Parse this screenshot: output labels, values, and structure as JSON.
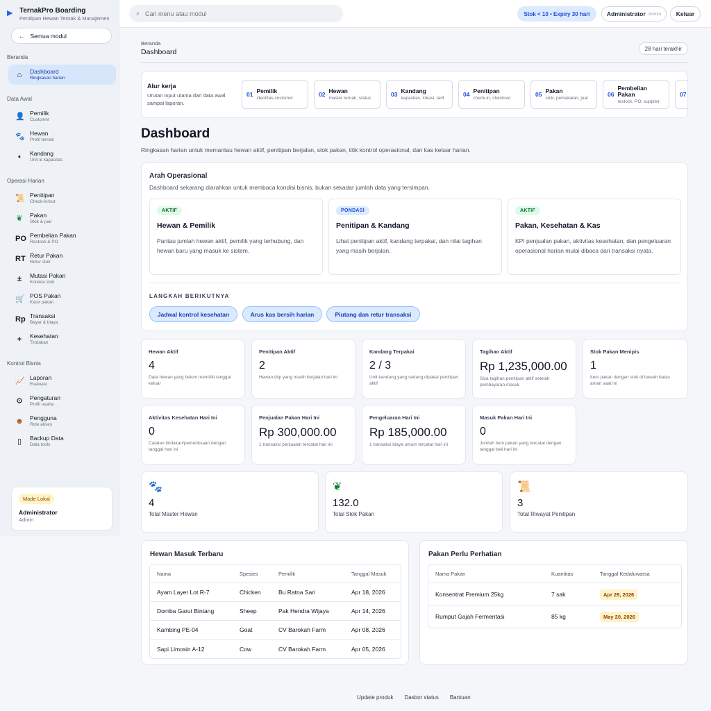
{
  "app": {
    "title": "TernakPro Boarding",
    "subtitle": "Penitipan Hewan Ternak & Manajemen"
  },
  "sidebar": {
    "all_modules": "Semua modul",
    "sections": [
      {
        "label": "Beranda",
        "items": [
          {
            "label": "Dashboard",
            "sub": "Ringkasan harian",
            "icon": "home-icon",
            "active": true
          }
        ]
      },
      {
        "label": "Data Awal",
        "items": [
          {
            "label": "Pemilik",
            "sub": "Customer",
            "icon": "user-icon"
          },
          {
            "label": "Hewan",
            "sub": "Profil ternak",
            "icon": "paw-icon"
          },
          {
            "label": "Kandang",
            "sub": "Unit & kapasitas",
            "icon": "barn-icon"
          }
        ]
      },
      {
        "label": "Operasi Harian",
        "items": [
          {
            "label": "Penitipan",
            "sub": "Check-in/out",
            "icon": "scroll-icon"
          },
          {
            "label": "Pakan",
            "sub": "Stok & jual",
            "icon": "leaf-icon"
          },
          {
            "label": "Pembelian Pakan",
            "sub": "Restock & PO",
            "icon": "po-icon"
          },
          {
            "label": "Retur Pakan",
            "sub": "Retur stok",
            "icon": "rt-icon"
          },
          {
            "label": "Mutasi Pakan",
            "sub": "Koreksi stok",
            "icon": "plus-minus-icon"
          },
          {
            "label": "POS Pakan",
            "sub": "Kasir pakan",
            "icon": "cart-icon"
          },
          {
            "label": "Transaksi",
            "sub": "Bayar & biaya",
            "icon": "rp-icon"
          },
          {
            "label": "Kesehatan",
            "sub": "Tindakan",
            "icon": "plus-icon"
          }
        ]
      },
      {
        "label": "Kontrol Bisnis",
        "items": [
          {
            "label": "Laporan",
            "sub": "Evaluasi",
            "icon": "chart-icon"
          },
          {
            "label": "Pengaturan",
            "sub": "Profil usaha",
            "icon": "gear-icon"
          },
          {
            "label": "Pengguna",
            "sub": "Role akses",
            "icon": "users-icon"
          },
          {
            "label": "Backup Data",
            "sub": "Data tools",
            "icon": "backup-icon"
          }
        ]
      }
    ],
    "mode": "Mode Lokal",
    "user": "Administrator",
    "role": "Admin"
  },
  "topbar": {
    "search_placeholder": "Cari menu atau modul",
    "stock_alert": "Stok < 10 • Expiry 30 hari",
    "user": "Administrator",
    "role": "Admin",
    "logout": "Keluar"
  },
  "breadcrumb": {
    "parent": "Beranda",
    "current": "Dashboard"
  },
  "range": "28 hari terakhir",
  "workflow": {
    "title": "Alur kerja",
    "desc": "Urutan input utama dari data awal sampai laporan.",
    "steps": [
      {
        "n": "01",
        "title": "Pemilik",
        "sub": "identitas customer"
      },
      {
        "n": "02",
        "title": "Hewan",
        "sub": "master ternak, status"
      },
      {
        "n": "03",
        "title": "Kandang",
        "sub": "kapasitas, lokasi, tarif"
      },
      {
        "n": "04",
        "title": "Penitipan",
        "sub": "check-in, checkout"
      },
      {
        "n": "05",
        "title": "Pakan",
        "sub": "stok, pemakaian, jual"
      },
      {
        "n": "06",
        "title": "Pembelian Pakan",
        "sub": "restock, PO, supplier"
      },
      {
        "n": "07",
        "title": "",
        "sub": ""
      }
    ]
  },
  "page": {
    "title": "Dashboard",
    "subtitle": "Ringkasan harian untuk memantau hewan aktif, penitipan berjalan, stok pakan, titik kontrol operasional, dan kas keluar harian."
  },
  "direction": {
    "title": "Arah Operasional",
    "subtitle": "Dashboard sekarang diarahkan untuk membaca kondisi bisnis, bukan sekadar jumlah data yang tersimpan.",
    "cards": [
      {
        "tag": "AKTIF",
        "tone": "g",
        "title": "Hewan & Pemilik",
        "desc": "Pantau jumlah hewan aktif, pemilik yang terhubung, dan hewan baru yang masuk ke sistem."
      },
      {
        "tag": "PONDASI",
        "tone": "b",
        "title": "Penitipan & Kandang",
        "desc": "Lihat penitipan aktif, kandang terpakai, dan nilai tagihan yang masih berjalan."
      },
      {
        "tag": "AKTIF",
        "tone": "g",
        "title": "Pakan, Kesehatan & Kas",
        "desc": "KPI penjualan pakan, aktivitas kesehatan, dan pengeluaran operasional harian mulai dibaca dari transaksi nyata."
      }
    ],
    "next_label": "LANGKAH BERIKUTNYA",
    "next": [
      "Jadwal kontrol kesehatan",
      "Arus kas bersih harian",
      "Piutang dan retur transaksi"
    ]
  },
  "kpis": [
    {
      "label": "Hewan Aktif",
      "value": "4",
      "desc": "Data hewan yang belum memiliki tanggal keluar"
    },
    {
      "label": "Penitipan Aktif",
      "value": "2",
      "desc": "Hewan titip yang masih berjalan hari ini"
    },
    {
      "label": "Kandang Terpakai",
      "value": "2 / 3",
      "desc": "Unit kandang yang sedang dipakai penitipan aktif"
    },
    {
      "label": "Tagihan Aktif",
      "value": "Rp 1,235,000.00",
      "desc": "Sisa tagihan penitipan aktif setelah pembayaran masuk"
    },
    {
      "label": "Stok Pakan Menipis",
      "value": "1",
      "desc": "Item pakan dengan stok di bawah batas aman saat ini"
    },
    {
      "label": "Aktivitas Kesehatan Hari Ini",
      "value": "0",
      "desc": "Catatan tindakan/pemeriksaan dengan tanggal hari ini"
    },
    {
      "label": "Penjualan Pakan Hari Ini",
      "value": "Rp 300,000.00",
      "desc": "1 transaksi penjualan tercatat hari ini"
    },
    {
      "label": "Pengeluaran Hari Ini",
      "value": "Rp 185,000.00",
      "desc": "1 transaksi biaya umum tercatat hari ini"
    },
    {
      "label": "Masuk Pakan Hari Ini",
      "value": "0",
      "desc": "Jumlah item pakan yang tercatat dengan tanggal beli hari ini"
    }
  ],
  "totals": [
    {
      "icon": "paw-icon",
      "value": "4",
      "label": "Total Master Hewan"
    },
    {
      "icon": "leaf-icon",
      "value": "132.0",
      "label": "Total Stok Pakan"
    },
    {
      "icon": "scroll-icon",
      "value": "3",
      "label": "Total Riwayat Penitipan"
    }
  ],
  "recent_animals": {
    "title": "Hewan Masuk Terbaru",
    "headers": [
      "Nama",
      "Spesies",
      "Pemilik",
      "Tanggal Masuk"
    ],
    "rows": [
      [
        "Ayam Layer Lot R-7",
        "Chicken",
        "Bu Ratna Sari",
        "Apr 18, 2026"
      ],
      [
        "Domba Garut Bintang",
        "Sheep",
        "Pak Hendra Wijaya",
        "Apr 14, 2026"
      ],
      [
        "Kambing PE-04",
        "Goat",
        "CV Barokah Farm",
        "Apr 08, 2026"
      ],
      [
        "Sapi Limosin A-12",
        "Cow",
        "CV Barokah Farm",
        "Apr 05, 2026"
      ]
    ]
  },
  "feed_attention": {
    "title": "Pakan Perlu Perhatian",
    "headers": [
      "Nama Pakan",
      "Kuantitas",
      "Tanggal Kedaluwarsa"
    ],
    "rows": [
      [
        "Konsentrat Premium 25kg",
        "7 sak",
        "Apr 29, 2026"
      ],
      [
        "Rumput Gajah Fermentasi",
        "85 kg",
        "May 20, 2026"
      ]
    ]
  },
  "footer": [
    "Update produk",
    "Dasbor status",
    "Bantuan"
  ]
}
